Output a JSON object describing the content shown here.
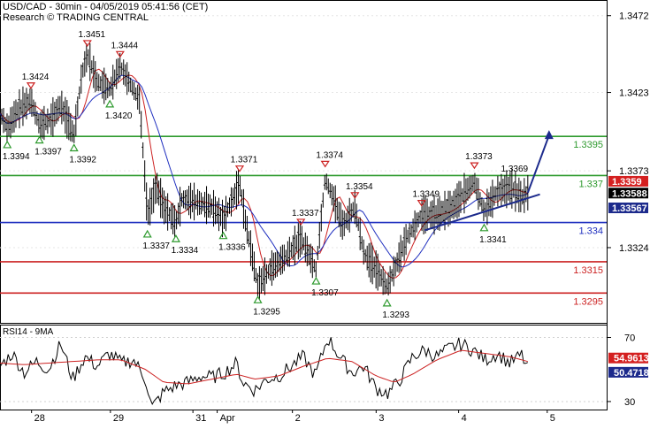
{
  "header": {
    "title": "USD/CAD - 30min - 04/05/2019 05:41:56 (CET)",
    "credit": "Research © TRADING CENTRAL"
  },
  "chart_data": [
    {
      "type": "line",
      "title": "USD/CAD - 30min - 04/05/2019 05:41:56 (CET)",
      "ylim": [
        1.3276,
        1.3482
      ],
      "y_ticks": [
        "1.3472",
        "1.3423",
        "1.3373",
        "1.3324"
      ],
      "x_ticks": [
        "28",
        "29",
        "31",
        "Apr",
        "2",
        "3",
        "4",
        "5"
      ],
      "levels": [
        {
          "label": "1.3395",
          "value": 1.3395,
          "color": "#2e9a2e"
        },
        {
          "label": "1.337",
          "value": 1.337,
          "color": "#2e9a2e"
        },
        {
          "label": "1.334",
          "value": 1.334,
          "color": "#1f2fbf"
        },
        {
          "label": "1.3315",
          "value": 1.3315,
          "color": "#cc2222"
        },
        {
          "label": "1.3295",
          "value": 1.3295,
          "color": "#cc2222"
        }
      ],
      "price_tags": [
        {
          "label": "1.3359",
          "value": 1.3359,
          "color": "#d42020"
        },
        {
          "label": "1.33588",
          "value": 1.33588,
          "color": "#000000"
        },
        {
          "label": "1.33567",
          "value": 1.33567,
          "color": "#1c2a8c"
        }
      ],
      "swing_highs": [
        {
          "label": "1.3424",
          "t": 0.051
        },
        {
          "label": "1.3451",
          "t": 0.144
        },
        {
          "label": "1.3444",
          "t": 0.198
        },
        {
          "label": "1.3371",
          "t": 0.395
        },
        {
          "label": "1.3337",
          "t": 0.496
        },
        {
          "label": "1.3374",
          "t": 0.536
        },
        {
          "label": "1.3354",
          "t": 0.585
        },
        {
          "label": "1.3349",
          "t": 0.695
        },
        {
          "label": "1.3373",
          "t": 0.782
        }
      ],
      "swing_lows": [
        {
          "label": "1.3394",
          "t": 0.012
        },
        {
          "label": "1.3397",
          "t": 0.065
        },
        {
          "label": "1.3392",
          "t": 0.122
        },
        {
          "label": "1.3420",
          "t": 0.181
        },
        {
          "label": "1.3337",
          "t": 0.243
        },
        {
          "label": "1.3334",
          "t": 0.29
        },
        {
          "label": "1.3336",
          "t": 0.368
        },
        {
          "label": "1.3295",
          "t": 0.425
        },
        {
          "label": "1.3307",
          "t": 0.521
        },
        {
          "label": "1.3293",
          "t": 0.638
        },
        {
          "label": "1.3341",
          "t": 0.798
        }
      ],
      "price_path": [
        [
          0.0,
          1.341
        ],
        [
          0.012,
          1.34
        ],
        [
          0.03,
          1.3412
        ],
        [
          0.051,
          1.3418
        ],
        [
          0.065,
          1.3402
        ],
        [
          0.085,
          1.3406
        ],
        [
          0.1,
          1.3415
        ],
        [
          0.122,
          1.3396
        ],
        [
          0.135,
          1.3435
        ],
        [
          0.144,
          1.3447
        ],
        [
          0.16,
          1.343
        ],
        [
          0.181,
          1.3425
        ],
        [
          0.198,
          1.344
        ],
        [
          0.215,
          1.3428
        ],
        [
          0.23,
          1.3418
        ],
        [
          0.243,
          1.3345
        ],
        [
          0.258,
          1.3363
        ],
        [
          0.27,
          1.335
        ],
        [
          0.29,
          1.334
        ],
        [
          0.3,
          1.3355
        ],
        [
          0.325,
          1.3353
        ],
        [
          0.35,
          1.335
        ],
        [
          0.368,
          1.3342
        ],
        [
          0.395,
          1.3365
        ],
        [
          0.405,
          1.334
        ],
        [
          0.425,
          1.33
        ],
        [
          0.445,
          1.331
        ],
        [
          0.47,
          1.3318
        ],
        [
          0.496,
          1.333
        ],
        [
          0.521,
          1.331
        ],
        [
          0.536,
          1.3368
        ],
        [
          0.55,
          1.3355
        ],
        [
          0.565,
          1.3338
        ],
        [
          0.585,
          1.335
        ],
        [
          0.6,
          1.332
        ],
        [
          0.62,
          1.331
        ],
        [
          0.638,
          1.3299
        ],
        [
          0.65,
          1.331
        ],
        [
          0.67,
          1.333
        ],
        [
          0.695,
          1.3345
        ],
        [
          0.72,
          1.3345
        ],
        [
          0.745,
          1.335
        ],
        [
          0.782,
          1.3366
        ],
        [
          0.798,
          1.3347
        ],
        [
          0.82,
          1.336
        ],
        [
          0.843,
          1.3362
        ],
        [
          0.86,
          1.3356
        ],
        [
          0.87,
          1.3359
        ]
      ],
      "forecast": {
        "label": "1.3369",
        "from": [
          0.87,
          1.3359
        ],
        "to": [
          0.905,
          1.3399
        ]
      },
      "trendline": {
        "from": [
          0.7,
          1.3335
        ],
        "to": [
          0.89,
          1.3358
        ]
      }
    },
    {
      "type": "line",
      "title": "RSI14 - 9MA",
      "ylim": [
        25,
        78
      ],
      "y_ticks": [
        "70",
        "30"
      ],
      "series": [
        {
          "name": "RSI14",
          "color": "#000000",
          "current": "50.4718",
          "values": [
            [
              0.0,
              52
            ],
            [
              0.02,
              60
            ],
            [
              0.04,
              48
            ],
            [
              0.06,
              55
            ],
            [
              0.08,
              50
            ],
            [
              0.1,
              66
            ],
            [
              0.12,
              44
            ],
            [
              0.14,
              58
            ],
            [
              0.16,
              52
            ],
            [
              0.18,
              60
            ],
            [
              0.2,
              54
            ],
            [
              0.22,
              56
            ],
            [
              0.24,
              44
            ],
            [
              0.25,
              26
            ],
            [
              0.27,
              36
            ],
            [
              0.29,
              40
            ],
            [
              0.31,
              42
            ],
            [
              0.33,
              46
            ],
            [
              0.35,
              45
            ],
            [
              0.37,
              48
            ],
            [
              0.39,
              54
            ],
            [
              0.4,
              42
            ],
            [
              0.42,
              37
            ],
            [
              0.44,
              44
            ],
            [
              0.46,
              46
            ],
            [
              0.48,
              52
            ],
            [
              0.5,
              58
            ],
            [
              0.52,
              46
            ],
            [
              0.54,
              70
            ],
            [
              0.56,
              58
            ],
            [
              0.58,
              48
            ],
            [
              0.6,
              52
            ],
            [
              0.62,
              38
            ],
            [
              0.64,
              35
            ],
            [
              0.66,
              44
            ],
            [
              0.68,
              58
            ],
            [
              0.7,
              62
            ],
            [
              0.72,
              58
            ],
            [
              0.74,
              63
            ],
            [
              0.76,
              66
            ],
            [
              0.78,
              62
            ],
            [
              0.8,
              56
            ],
            [
              0.82,
              60
            ],
            [
              0.84,
              54
            ],
            [
              0.86,
              59
            ],
            [
              0.87,
              50
            ]
          ]
        },
        {
          "name": "9MA",
          "color": "#cc2222",
          "current": "54.9613",
          "values": [
            [
              0.0,
              54
            ],
            [
              0.04,
              53
            ],
            [
              0.08,
              54
            ],
            [
              0.12,
              55
            ],
            [
              0.16,
              56
            ],
            [
              0.2,
              56
            ],
            [
              0.24,
              50
            ],
            [
              0.27,
              42
            ],
            [
              0.31,
              41
            ],
            [
              0.35,
              44
            ],
            [
              0.39,
              47
            ],
            [
              0.42,
              44
            ],
            [
              0.46,
              46
            ],
            [
              0.5,
              52
            ],
            [
              0.54,
              57
            ],
            [
              0.58,
              55
            ],
            [
              0.62,
              46
            ],
            [
              0.65,
              42
            ],
            [
              0.68,
              47
            ],
            [
              0.72,
              56
            ],
            [
              0.76,
              62
            ],
            [
              0.8,
              60
            ],
            [
              0.84,
              58
            ],
            [
              0.87,
              55
            ]
          ]
        }
      ]
    }
  ]
}
